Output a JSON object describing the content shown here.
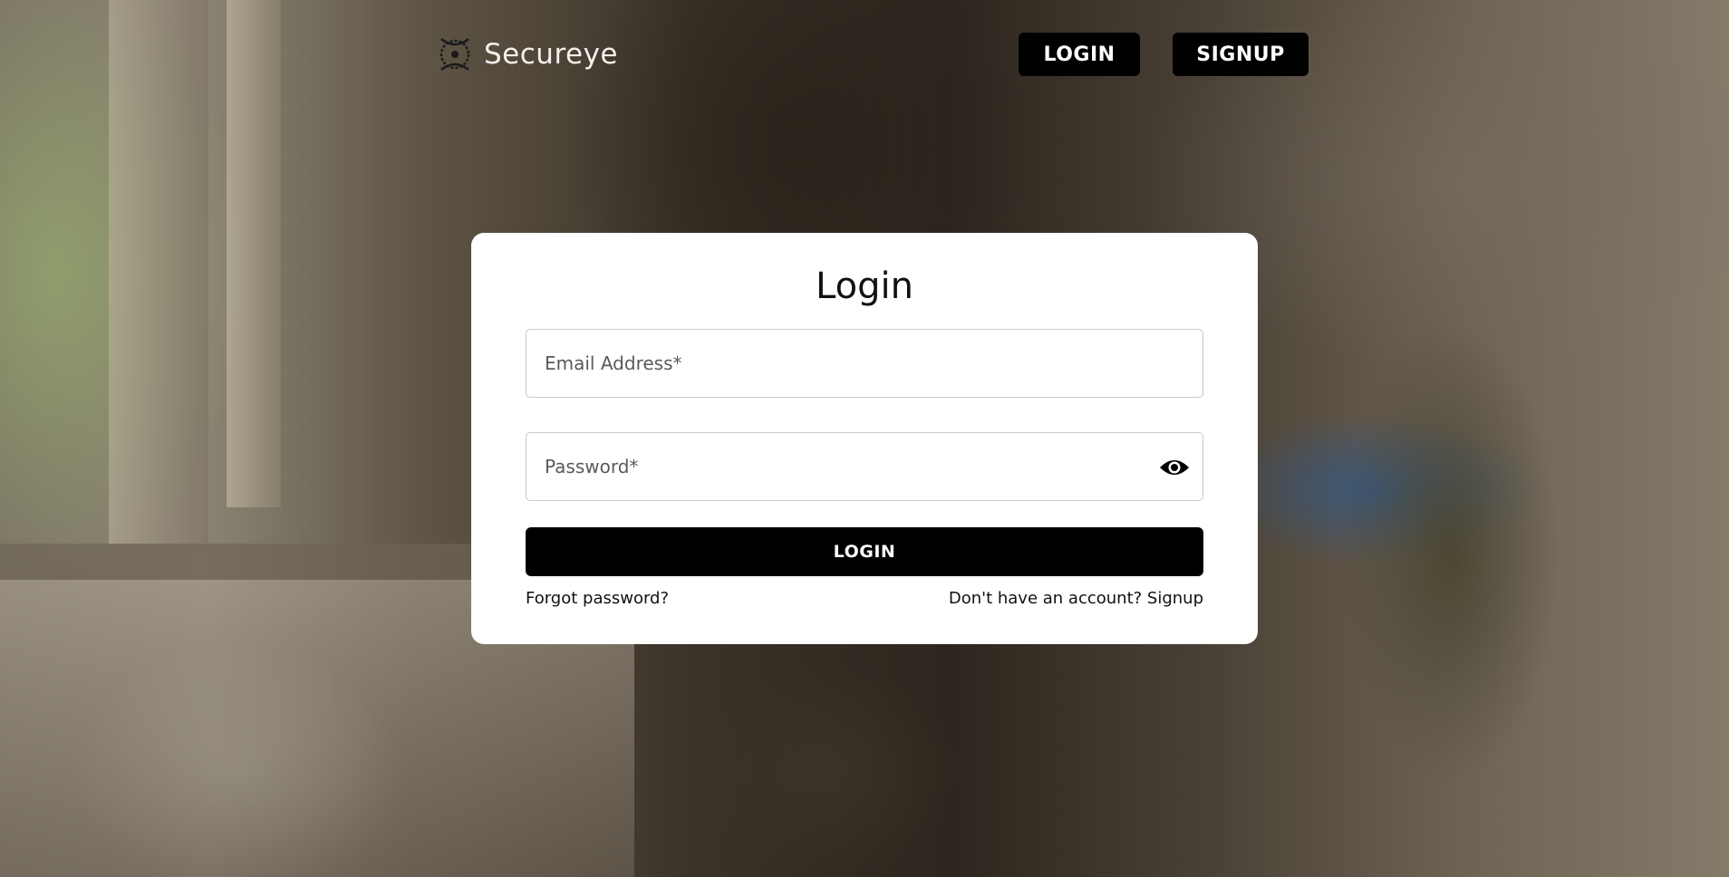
{
  "brand": {
    "name": "Secureye",
    "logo_icon": "eye-emblem-icon"
  },
  "nav": {
    "login_label": "LOGIN",
    "signup_label": "SIGNUP"
  },
  "login_form": {
    "title": "Login",
    "email": {
      "placeholder": "Email Address*",
      "value": ""
    },
    "password": {
      "placeholder": "Password*",
      "value": "",
      "toggle_icon": "eye-icon"
    },
    "submit_label": "LOGIN",
    "forgot_password_label": "Forgot password?",
    "signup_prompt_label": "Don't have an account? Signup"
  },
  "colors": {
    "button_background": "#000000",
    "button_text": "#ffffff",
    "card_background": "#ffffff",
    "field_border": "#c8c8c8"
  }
}
